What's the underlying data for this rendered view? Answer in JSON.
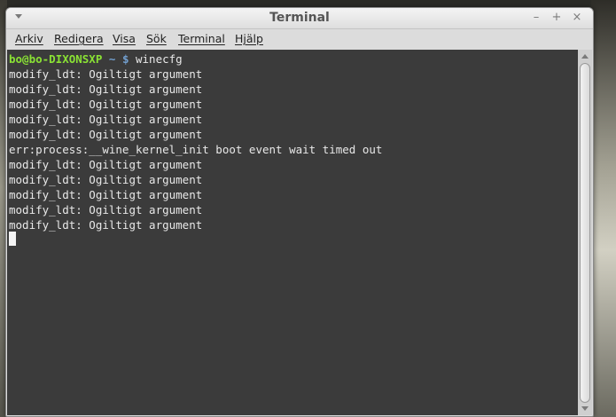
{
  "window": {
    "title": "Terminal",
    "controls": {
      "minimize": "–",
      "maximize": "+",
      "close": "×"
    }
  },
  "menubar": {
    "items": [
      {
        "label": "Arkiv"
      },
      {
        "label": "Redigera"
      },
      {
        "label": "Visa"
      },
      {
        "label": "Sök"
      },
      {
        "label": "Terminal"
      },
      {
        "label": "Hjälp"
      }
    ]
  },
  "terminal": {
    "prompt": {
      "user_host": "bo@bo-DIXONSXP",
      "path": "~ $",
      "command": " winecfg"
    },
    "output": [
      "modify_ldt: Ogiltigt argument",
      "modify_ldt: Ogiltigt argument",
      "modify_ldt: Ogiltigt argument",
      "modify_ldt: Ogiltigt argument",
      "modify_ldt: Ogiltigt argument",
      "err:process:__wine_kernel_init boot event wait timed out",
      "modify_ldt: Ogiltigt argument",
      "modify_ldt: Ogiltigt argument",
      "modify_ldt: Ogiltigt argument",
      "modify_ldt: Ogiltigt argument",
      "modify_ldt: Ogiltigt argument"
    ]
  },
  "colors": {
    "terminal_bg": "#3b3b3b",
    "terminal_fg": "#e8e8e8",
    "prompt_user": "#8ae234",
    "prompt_path": "#729fcf"
  },
  "icons": {
    "window_menu": "chevron-down-icon",
    "scroll_up": "arrow-up-icon",
    "scroll_down": "arrow-down-icon"
  }
}
